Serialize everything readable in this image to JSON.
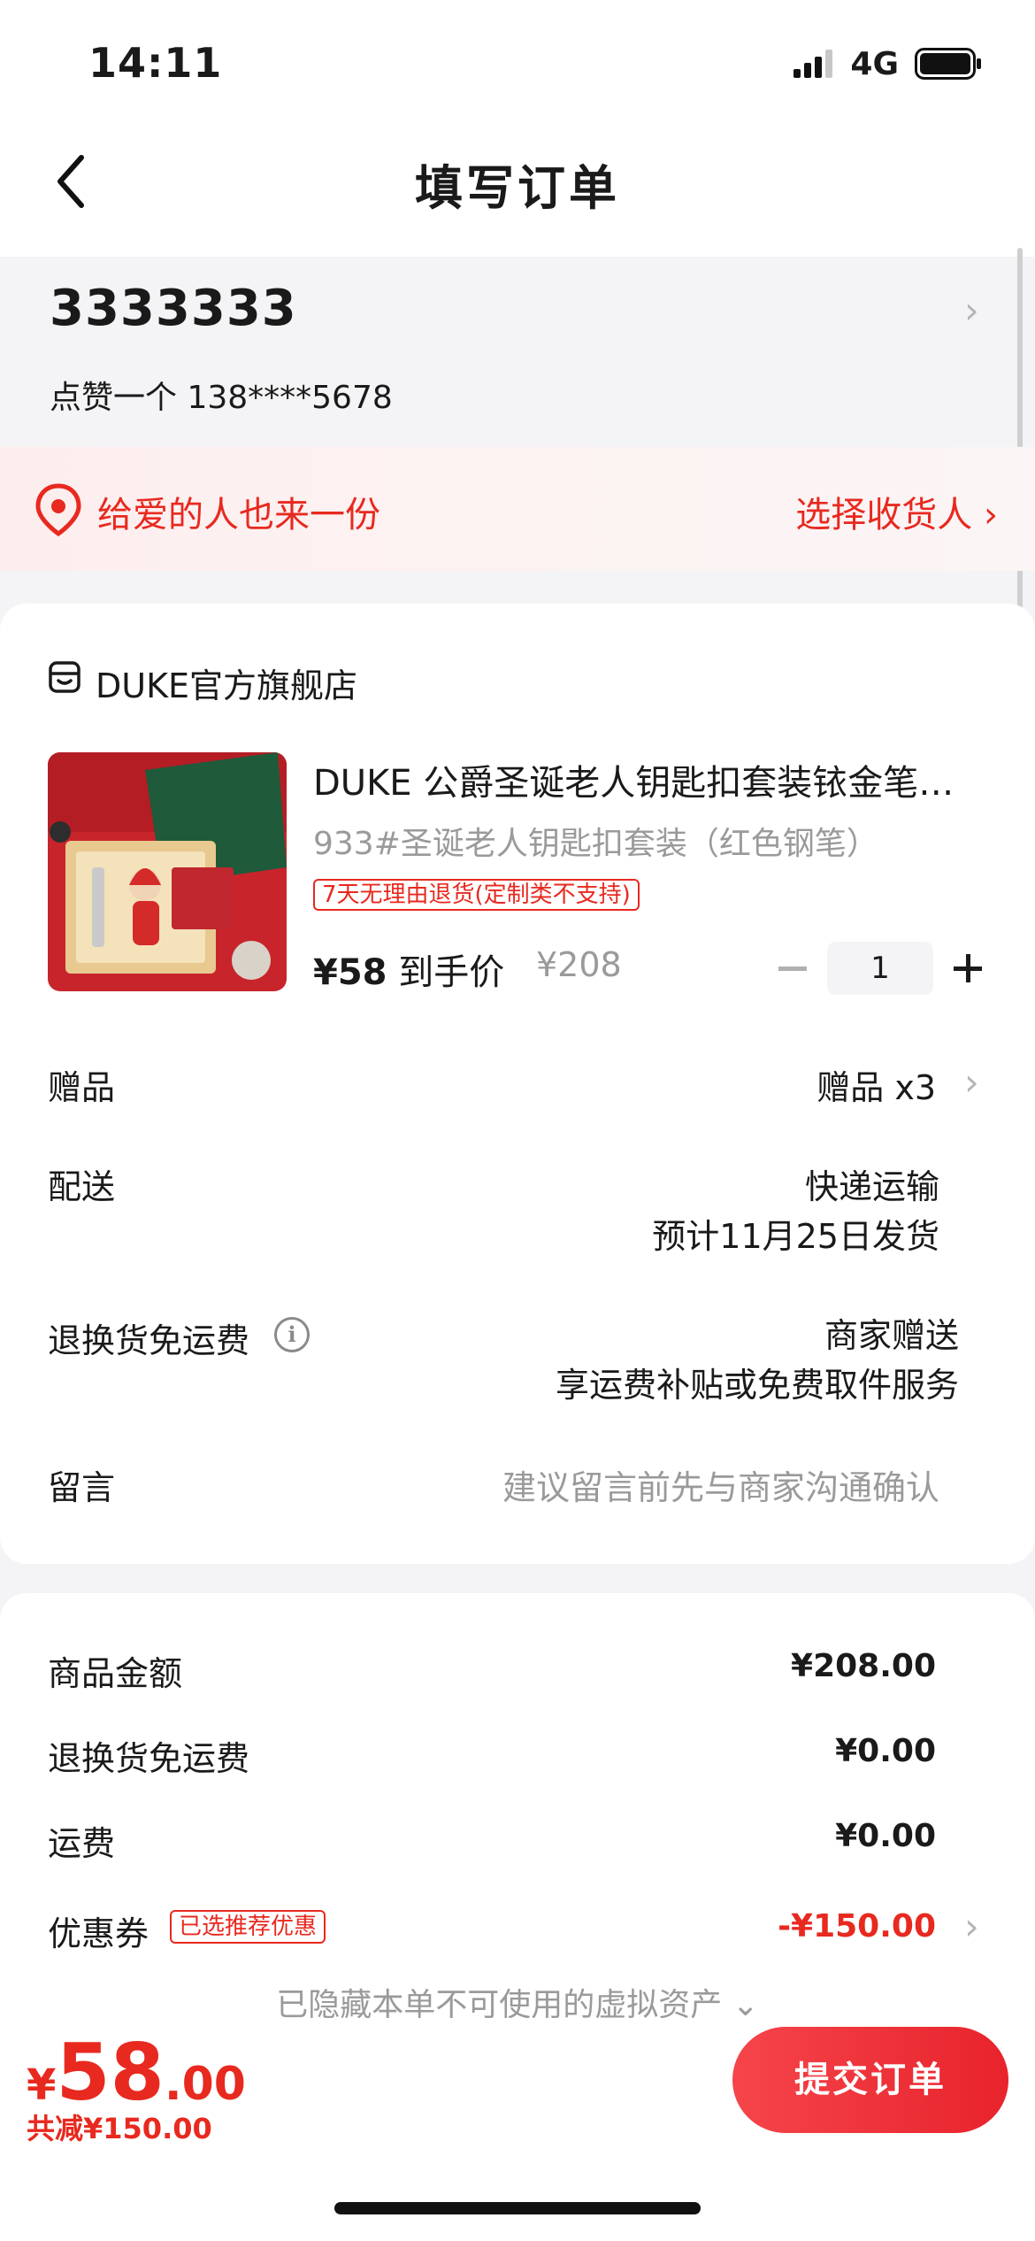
{
  "status_bar": {
    "time": "14:11",
    "network": "4G"
  },
  "nav": {
    "title": "填写订单"
  },
  "address": {
    "name": "3333333",
    "contact": "点赞一个  138****5678"
  },
  "gift_banner": {
    "text": "给爱的人也来一份",
    "action": "选择收货人 ›"
  },
  "shop": {
    "name": "DUKE官方旗舰店"
  },
  "product": {
    "title": "DUKE 公爵圣诞老人钥匙扣套装铱金笔…",
    "spec": "933#圣诞老人钥匙扣套装（红色钢笔）",
    "return_tag": "7天无理由退货(定制类不支持)",
    "price": "¥58",
    "price_label": " 到手价",
    "original_price": "¥208",
    "quantity": "1"
  },
  "rows": {
    "gift_label": "赠品",
    "gift_value": "赠品 x3",
    "delivery_label": "配送",
    "delivery_method": "快递运输",
    "delivery_eta": "预计11月25日发货",
    "return_free_label": "退换货免运费",
    "return_free_value1": "商家赠送",
    "return_free_value2": "享运费补贴或免费取件服务",
    "message_label": "留言",
    "message_placeholder": "建议留言前先与商家沟通确认"
  },
  "summary": {
    "goods_label": "商品金额",
    "goods_value": "¥208.00",
    "return_free_label": "退换货免运费",
    "return_free_value": "¥0.00",
    "shipping_label": "运费",
    "shipping_value": "¥0.00",
    "coupon_label": "优惠券",
    "coupon_tag": "已选推荐优惠",
    "coupon_value": "-¥150.00",
    "hidden_assets": "已隐藏本单不可使用的虚拟资产 ⌄"
  },
  "bottom": {
    "currency": "¥",
    "total_int": "58",
    "total_dec": ".00",
    "discount": "共减¥150.00",
    "submit": "提交订单"
  },
  "colors": {
    "accent": "#e8291f",
    "background": "#f4f4f6"
  }
}
